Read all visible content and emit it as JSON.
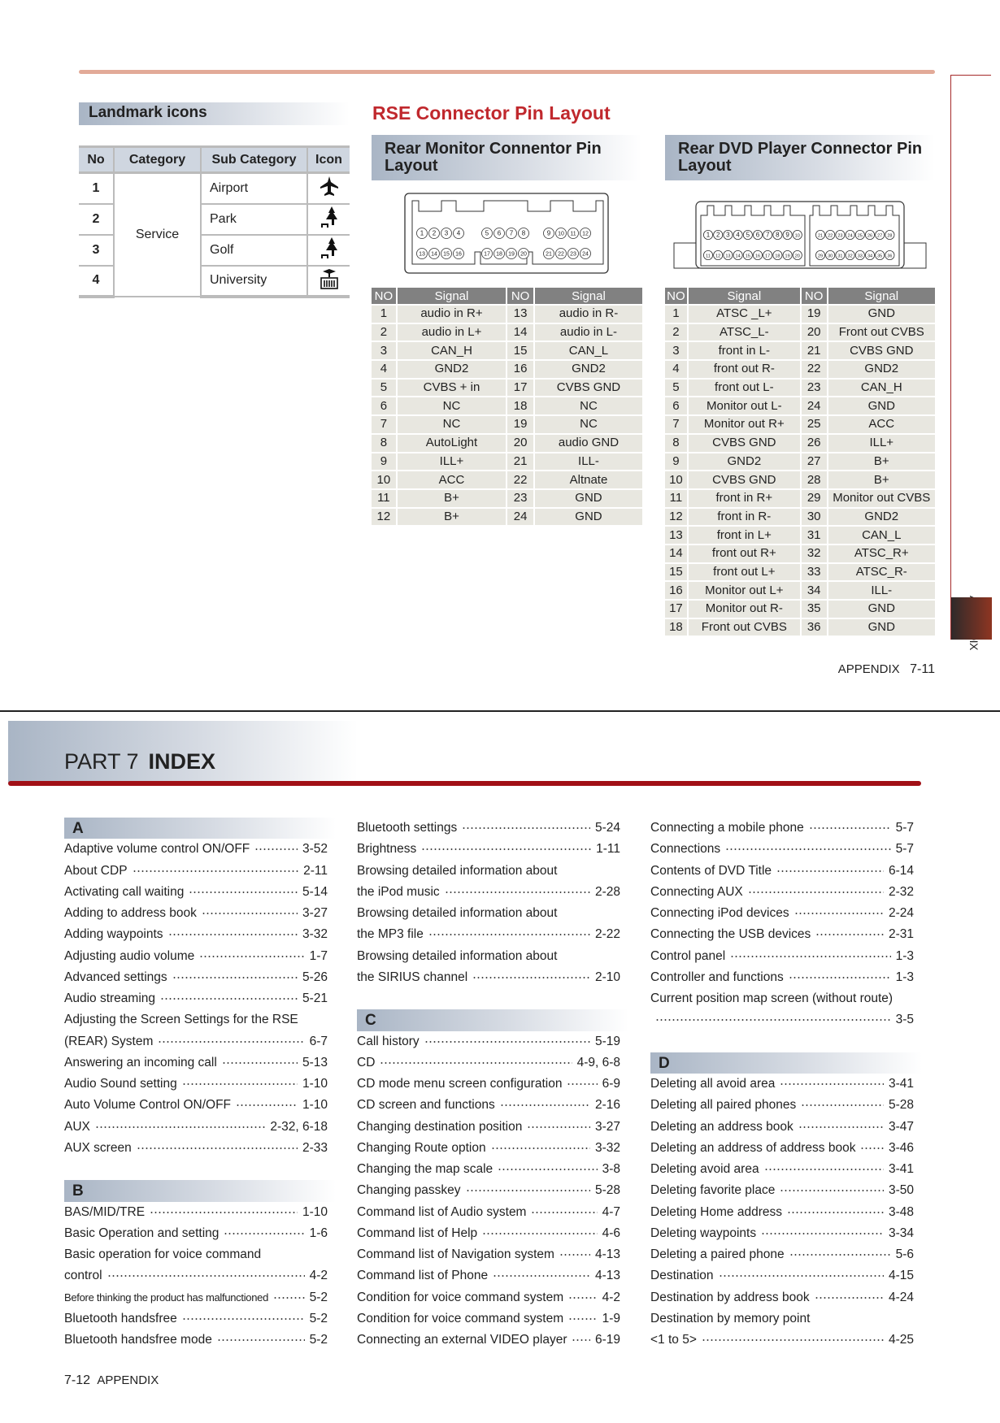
{
  "landmark": {
    "title": "Landmark icons",
    "headers": [
      "No",
      "Category",
      "Sub Category",
      "Icon"
    ],
    "category": "Service",
    "rows": [
      {
        "no": "1",
        "sub": "Airport",
        "icon": "airplane-icon"
      },
      {
        "no": "2",
        "sub": "Park",
        "icon": "tree-bench-icon"
      },
      {
        "no": "3",
        "sub": "Golf",
        "icon": "tree-bench-icon"
      },
      {
        "no": "4",
        "sub": "University",
        "icon": "university-building-icon"
      }
    ]
  },
  "rse": {
    "title": "RSE Connector Pin Layout",
    "monitor": {
      "title": "Rear Monitor Connentor Pin Layout",
      "headers": [
        "NO",
        "Signal",
        "NO",
        "Signal"
      ],
      "pins_row1": [
        [
          1,
          2,
          3,
          4
        ],
        [
          5,
          6,
          7,
          8
        ],
        [
          9,
          10,
          11,
          12
        ]
      ],
      "pins_row2": [
        [
          13,
          14,
          15,
          16
        ],
        [
          17,
          18,
          19,
          20
        ],
        [
          21,
          22,
          23,
          24
        ]
      ],
      "rows": [
        [
          "1",
          "audio in R+",
          "13",
          "audio in R-"
        ],
        [
          "2",
          "audio in L+",
          "14",
          "audio in L-"
        ],
        [
          "3",
          "CAN_H",
          "15",
          "CAN_L"
        ],
        [
          "4",
          "GND2",
          "16",
          "GND2"
        ],
        [
          "5",
          "CVBS + in",
          "17",
          "CVBS GND"
        ],
        [
          "6",
          "NC",
          "18",
          "NC"
        ],
        [
          "7",
          "NC",
          "19",
          "NC"
        ],
        [
          "8",
          "AutoLight",
          "20",
          "audio GND"
        ],
        [
          "9",
          "ILL+",
          "21",
          "ILL-"
        ],
        [
          "10",
          "ACC",
          "22",
          "Altnate"
        ],
        [
          "11",
          "B+",
          "23",
          "GND"
        ],
        [
          "12",
          "B+",
          "24",
          "GND"
        ]
      ]
    },
    "dvd": {
      "title": "Rear DVD Player Connector Pin Layout",
      "headers": [
        "NO",
        "Signal",
        "NO",
        "Signal"
      ],
      "pins_row1": [
        [
          1,
          2,
          3,
          4,
          5,
          6,
          7,
          8,
          9,
          10
        ],
        [
          21,
          22,
          23,
          24,
          25,
          26,
          27,
          28
        ]
      ],
      "pins_row2": [
        [
          11,
          12,
          13,
          14,
          15,
          16,
          17,
          18,
          19,
          20
        ],
        [
          29,
          30,
          31,
          32,
          33,
          34,
          35,
          36
        ]
      ],
      "rows": [
        [
          "1",
          "ATSC _L+",
          "19",
          "GND"
        ],
        [
          "2",
          "ATSC_L-",
          "20",
          "Front out CVBS"
        ],
        [
          "3",
          "front in L-",
          "21",
          "CVBS GND"
        ],
        [
          "4",
          "front out R-",
          "22",
          "GND2"
        ],
        [
          "5",
          "front out L-",
          "23",
          "CAN_H"
        ],
        [
          "6",
          "Monitor out L-",
          "24",
          "GND"
        ],
        [
          "7",
          "Monitor out R+",
          "25",
          "ACC"
        ],
        [
          "8",
          "CVBS GND",
          "26",
          "ILL+"
        ],
        [
          "9",
          "GND2",
          "27",
          "B+"
        ],
        [
          "10",
          "CVBS GND",
          "28",
          "B+"
        ],
        [
          "11",
          "front in R+",
          "29",
          "Monitor out CVBS"
        ],
        [
          "12",
          "front in R-",
          "30",
          "GND2"
        ],
        [
          "13",
          "front in L+",
          "31",
          "CAN_L"
        ],
        [
          "14",
          "front out R+",
          "32",
          "ATSC_R+"
        ],
        [
          "15",
          "front out L+",
          "33",
          "ATSC_R-"
        ],
        [
          "16",
          "Monitor out L+",
          "34",
          "ILL-"
        ],
        [
          "17",
          "Monitor out R-",
          "35",
          "GND"
        ],
        [
          "18",
          "Front out CVBS",
          "36",
          "GND"
        ]
      ]
    }
  },
  "side_tab": "APPENDIX",
  "page_footer_right": {
    "section": "APPENDIX",
    "page": "7-11"
  },
  "index": {
    "part": "PART 7",
    "title": "INDEX",
    "columns": [
      [
        {
          "h": "A"
        },
        {
          "t": "Adaptive volume control ON/OFF",
          "p": "3-52"
        },
        {
          "t": "About CDP",
          "p": "2-11"
        },
        {
          "t": "Activating call waiting",
          "p": "5-14"
        },
        {
          "t": "Adding to address book",
          "p": "3-27"
        },
        {
          "t": "Adding waypoints",
          "p": "3-32"
        },
        {
          "t": "Adjusting audio volume",
          "p": "1-7"
        },
        {
          "t": "Advanced settings",
          "p": "5-26"
        },
        {
          "t": "Audio streaming",
          "p": "5-21"
        },
        {
          "t": "Adjusting the Screen Settings for the RSE"
        },
        {
          "t": "(REAR) System",
          "p": "6-7"
        },
        {
          "t": "Answering an incoming call",
          "p": "5-13"
        },
        {
          "t": "Audio Sound setting",
          "p": "1-10"
        },
        {
          "t": "Auto Volume Control ON/OFF",
          "p": "1-10"
        },
        {
          "t": "AUX",
          "p": "2-32, 6-18"
        },
        {
          "t": "AUX screen",
          "p": "2-33"
        },
        {},
        {
          "h": "B"
        },
        {
          "t": "BAS/MID/TRE",
          "p": "1-10"
        },
        {
          "t": "Basic Operation and setting",
          "p": "1-6"
        },
        {
          "t": "Basic operation for voice command"
        },
        {
          "t": "control",
          "p": "4-2"
        },
        {
          "t": "Before thinking the product has malfunctioned",
          "p": "5-2",
          "small": true
        },
        {
          "t": "Bluetooth handsfree",
          "p": "5-2"
        },
        {
          "t": "Bluetooth handsfree mode",
          "p": "5-2"
        }
      ],
      [
        {
          "t": "Bluetooth settings",
          "p": "5-24"
        },
        {
          "t": "Brightness",
          "p": "1-11"
        },
        {
          "t": "Browsing detailed information about"
        },
        {
          "t": "the iPod music",
          "p": "2-28"
        },
        {
          "t": "Browsing detailed information about"
        },
        {
          "t": "the MP3 file",
          "p": "2-22"
        },
        {
          "t": "Browsing detailed information about"
        },
        {
          "t": "the SIRIUS channel",
          "p": "2-10"
        },
        {},
        {
          "h": "C"
        },
        {
          "t": "Call history",
          "p": "5-19"
        },
        {
          "t": "CD",
          "p": "4-9, 6-8"
        },
        {
          "t": "CD mode menu screen configuration",
          "p": "6-9"
        },
        {
          "t": "CD screen and functions",
          "p": "2-16"
        },
        {
          "t": "Changing destination position",
          "p": "3-27"
        },
        {
          "t": "Changing Route option",
          "p": "3-32"
        },
        {
          "t": "Changing the map scale",
          "p": "3-8"
        },
        {
          "t": "Changing passkey",
          "p": "5-28"
        },
        {
          "t": "Command list of Audio system",
          "p": "4-7"
        },
        {
          "t": "Command list of Help",
          "p": "4-6"
        },
        {
          "t": "Command list of Navigation system",
          "p": "4-13"
        },
        {
          "t": "Command list of Phone",
          "p": "4-13"
        },
        {
          "t": "Condition for voice command system",
          "p": "4-2"
        },
        {
          "t": "Condition for voice command system",
          "p": "1-9"
        },
        {
          "t": "Connecting an external VIDEO player",
          "p": "6-19"
        }
      ],
      [
        {
          "t": "Connecting a mobile phone",
          "p": "5-7"
        },
        {
          "t": "Connections",
          "p": "5-7"
        },
        {
          "t": "Contents of DVD Title",
          "p": "6-14"
        },
        {
          "t": "Connecting AUX",
          "p": "2-32"
        },
        {
          "t": "Connecting iPod devices",
          "p": "2-24"
        },
        {
          "t": "Connecting the USB devices",
          "p": "2-31"
        },
        {
          "t": "Control panel",
          "p": "1-3"
        },
        {
          "t": "Controller and functions",
          "p": "1-3"
        },
        {
          "t": "Current position map screen (without route)"
        },
        {
          "t": "",
          "p": "3-5"
        },
        {},
        {
          "h": "D"
        },
        {
          "t": "Deleting all avoid area",
          "p": "3-41"
        },
        {
          "t": "Deleting all paired phones",
          "p": "5-28"
        },
        {
          "t": "Deleting an address book",
          "p": "3-47"
        },
        {
          "t": "Deleting an address of address book",
          "p": "3-46"
        },
        {
          "t": "Deleting avoid area",
          "p": "3-41"
        },
        {
          "t": "Deleting favorite place",
          "p": "3-50"
        },
        {
          "t": "Deleting Home address",
          "p": "3-48"
        },
        {
          "t": "Deleting waypoints",
          "p": "3-34"
        },
        {
          "t": "Deleting a paired phone",
          "p": "5-6"
        },
        {
          "t": "Destination",
          "p": "4-15"
        },
        {
          "t": "Destination by address book",
          "p": "4-24"
        },
        {
          "t": "Destination by memory point"
        },
        {
          "t": "<1 to 5>",
          "p": "4-25"
        }
      ]
    ]
  },
  "page_footer_left": {
    "page": "7-12",
    "section": "APPENDIX"
  },
  "colors": {
    "accent_red": "#a11016",
    "title_red": "#c0282d",
    "table_header": "#818181",
    "table_cell": "#e8e7e0",
    "top_rule": "#e2aa98"
  }
}
